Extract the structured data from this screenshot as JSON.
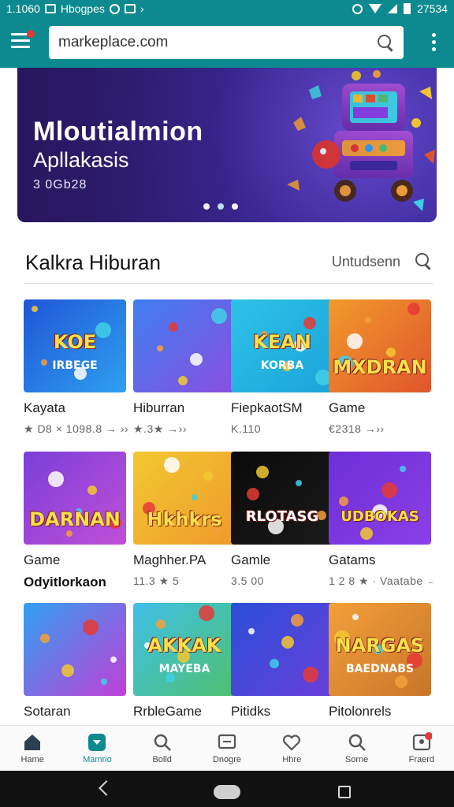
{
  "status_bar": {
    "time": "1.1060",
    "notification_text": "Hbogpes",
    "battery_text": "27534"
  },
  "app_bar": {
    "search_value": "markeplace.com"
  },
  "banner": {
    "title": "Mloutialmion",
    "subtitle": "Apllakasis",
    "meta": "3 0Gb28",
    "dots": 3,
    "active_dot": 1
  },
  "section": {
    "title": "Kalkra Hiburan",
    "link": "Untudsenn"
  },
  "apps": [
    {
      "name": "Kayata",
      "meta": "★ D8 × 1098.8 → ››",
      "thumb_text": "KOE",
      "thumb_sub": "IRBEGE",
      "colors": [
        "#1f56d6",
        "#2fa0f0"
      ]
    },
    {
      "name": "Hiburran",
      "meta": "★.3★          →››",
      "thumb_text": "",
      "thumb_sub": "",
      "colors": [
        "#3f7ff0",
        "#8a4ee0"
      ]
    },
    {
      "name": "FiepkaotSM",
      "meta": "K.110",
      "thumb_text": "KEAN",
      "thumb_sub": "KORBA",
      "colors": [
        "#2ec2e8",
        "#1aa4d8"
      ]
    },
    {
      "name": "Game",
      "meta": "€2318          →››",
      "thumb_text": "MXDRAN",
      "thumb_sub": "",
      "colors": [
        "#f29a2c",
        "#e0552c"
      ]
    },
    {
      "name": "Game",
      "meta": "Odyitlorkaon",
      "meta_dark": true,
      "thumb_text": "DARNAN",
      "thumb_sub": "",
      "colors": [
        "#7a3fd8",
        "#c14fd8"
      ]
    },
    {
      "name": "Maghher.PA",
      "meta": "11.3 ★ 5",
      "thumb_text": "Hkhkrs",
      "thumb_sub": "",
      "colors": [
        "#f2c832",
        "#ef9a2a"
      ]
    },
    {
      "name": "Gamle",
      "meta": "3.5 00",
      "thumb_text": "RLOTASG",
      "thumb_sub": "",
      "colors": [
        "#0a0a0a",
        "#1a1a1a"
      ]
    },
    {
      "name": "Gatams",
      "meta": "1 2 8 ★ · Vaatabe →›",
      "thumb_text": "UDBOKAS",
      "thumb_sub": "",
      "colors": [
        "#6e2fd6",
        "#8a3fe8"
      ]
    },
    {
      "name": "Sotaran",
      "meta": "",
      "thumb_text": "",
      "thumb_sub": "",
      "colors": [
        "#2fa0f0",
        "#c23fd8"
      ]
    },
    {
      "name": "RrbleGame",
      "meta": "",
      "thumb_text": "AKKAK",
      "thumb_sub": "MAYEBA",
      "colors": [
        "#3fc0e8",
        "#4fc070"
      ]
    },
    {
      "name": "Pitidks",
      "meta": "",
      "thumb_text": "",
      "thumb_sub": "",
      "colors": [
        "#2a4fd8",
        "#6a3fd8"
      ]
    },
    {
      "name": "Pitolonrels",
      "meta": "",
      "thumb_text": "NARGAS",
      "thumb_sub": "BAEDNABS",
      "colors": [
        "#f2a03a",
        "#c8752a"
      ]
    }
  ],
  "bottom_nav": [
    {
      "label": "Hame",
      "icon": "home-icon",
      "active": false
    },
    {
      "label": "Mamrio",
      "icon": "apps-icon",
      "active": true
    },
    {
      "label": "Bolld",
      "icon": "search-icon",
      "active": false
    },
    {
      "label": "Dnogre",
      "icon": "message-icon",
      "active": false
    },
    {
      "label": "Hhre",
      "icon": "heart-icon",
      "active": false
    },
    {
      "label": "Sorne",
      "icon": "search-icon",
      "active": false
    },
    {
      "label": "Fraerd",
      "icon": "profile-icon",
      "active": false
    }
  ]
}
